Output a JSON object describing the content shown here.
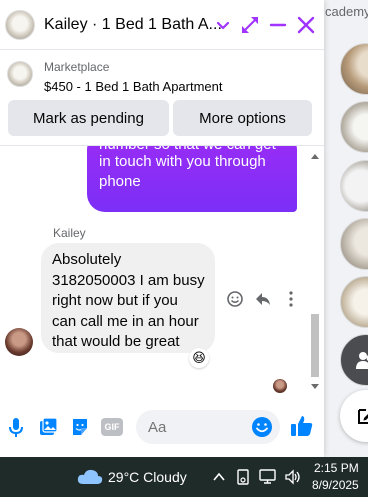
{
  "colors": {
    "accent": "#a033ff",
    "outgoing_bubble": "#9b2cf5",
    "incoming_bubble": "#f0f0f0",
    "messenger_blue": "#0084ff",
    "taskbar": "#1f2b28"
  },
  "background": {
    "partial_text": "cademy"
  },
  "header": {
    "title": "Kailey · 1 Bed 1 Bath A...",
    "icons": [
      "chevron-down-icon",
      "expand-icon",
      "minimize-icon",
      "close-icon"
    ]
  },
  "listing": {
    "category": "Marketplace",
    "title": "$450 - 1 Bed 1 Bath Apartment",
    "buttons": {
      "pending": "Mark as pending",
      "more": "More options"
    }
  },
  "messages": {
    "outgoing": {
      "lines": [
        "number so that we can get",
        "in touch with you through",
        "phone"
      ]
    },
    "incoming": {
      "sender": "Kailey",
      "lines": [
        "Absolutely",
        "3182050003 I am busy",
        "right now but if you",
        "can call me in an hour",
        "that would be great"
      ],
      "reaction": "😆"
    }
  },
  "composer": {
    "placeholder": "Aa",
    "icons": [
      "microphone-icon",
      "photo-icon",
      "sticker-icon",
      "gif-icon",
      "emoji-icon",
      "thumbs-up-icon"
    ],
    "gif_label": "GIF"
  },
  "taskbar": {
    "weather": "29°C  Cloudy",
    "time": "2:15 PM",
    "date": "8/9/2025"
  }
}
